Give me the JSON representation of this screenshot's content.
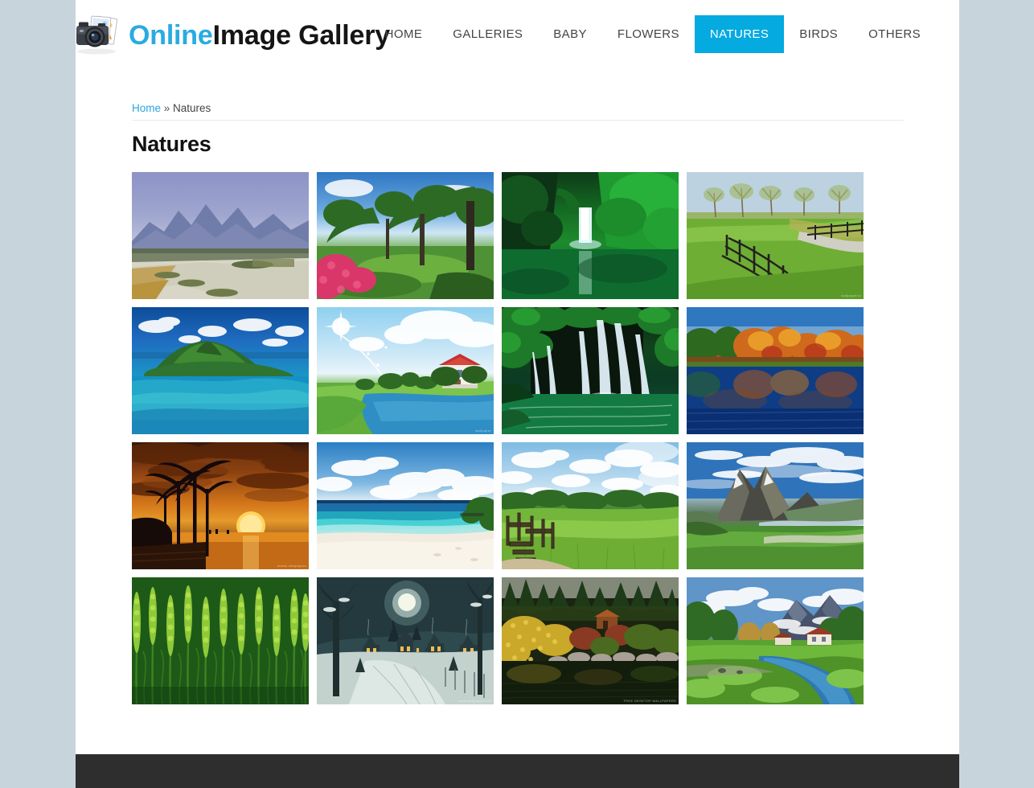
{
  "site": {
    "background_color": "#c8d4dc",
    "container_color": "#ffffff",
    "accent_color": "#04aae0",
    "footer_color": "#2e2e2e"
  },
  "header": {
    "logo_icon": "camera-photos-icon",
    "brand_primary": "Online",
    "brand_secondary": "Image Gallery",
    "nav": [
      {
        "label": "HOME",
        "active": false
      },
      {
        "label": "GALLERIES",
        "active": false
      },
      {
        "label": "BABY",
        "active": false
      },
      {
        "label": "FLOWERS",
        "active": false
      },
      {
        "label": "NATURES",
        "active": true
      },
      {
        "label": "BIRDS",
        "active": false
      },
      {
        "label": "OTHERS",
        "active": false
      }
    ]
  },
  "breadcrumb": {
    "home_label": "Home",
    "separator": "»",
    "current_label": "Natures"
  },
  "main": {
    "page_title": "Natures",
    "gallery": [
      {
        "alt": "River valley with karst mountains",
        "scene": "s1",
        "watermark": ""
      },
      {
        "alt": "Oak alley with pink azaleas and green lawn",
        "scene": "s2",
        "watermark": ""
      },
      {
        "alt": "Waterfall into emerald green pool",
        "scene": "s3",
        "watermark": ""
      },
      {
        "alt": "Wooden fence along green pasture road",
        "scene": "s4",
        "watermark": "wallpaper.in"
      },
      {
        "alt": "Tropical island in turquoise sea",
        "scene": "s5",
        "watermark": ""
      },
      {
        "alt": "House by a lake under sunny sky",
        "scene": "s6",
        "watermark": "wallpaper"
      },
      {
        "alt": "Large waterfalls in forest",
        "scene": "s7",
        "watermark": ""
      },
      {
        "alt": "Autumn trees reflected in blue lake",
        "scene": "s8",
        "watermark": ""
      },
      {
        "alt": "Palm trees silhouette at orange sunset",
        "scene": "s9",
        "watermark": "dream wallpapers"
      },
      {
        "alt": "White sand tropical beach",
        "scene": "s10",
        "watermark": ""
      },
      {
        "alt": "Wooden steps beside green meadow",
        "scene": "s11",
        "watermark": ""
      },
      {
        "alt": "Mountain peaks above green valley river",
        "scene": "s12",
        "watermark": ""
      },
      {
        "alt": "Close up of green wheat field",
        "scene": "s13",
        "watermark": ""
      },
      {
        "alt": "Snowy village at night with moon",
        "scene": "s14",
        "watermark": "www.wallpapers.net"
      },
      {
        "alt": "Autumn garden pond with cabin",
        "scene": "s15",
        "watermark": "FREE DESKTOP WALLPAPERS"
      },
      {
        "alt": "Alpine river valley with houses and mountain",
        "scene": "s16",
        "watermark": ""
      }
    ]
  }
}
